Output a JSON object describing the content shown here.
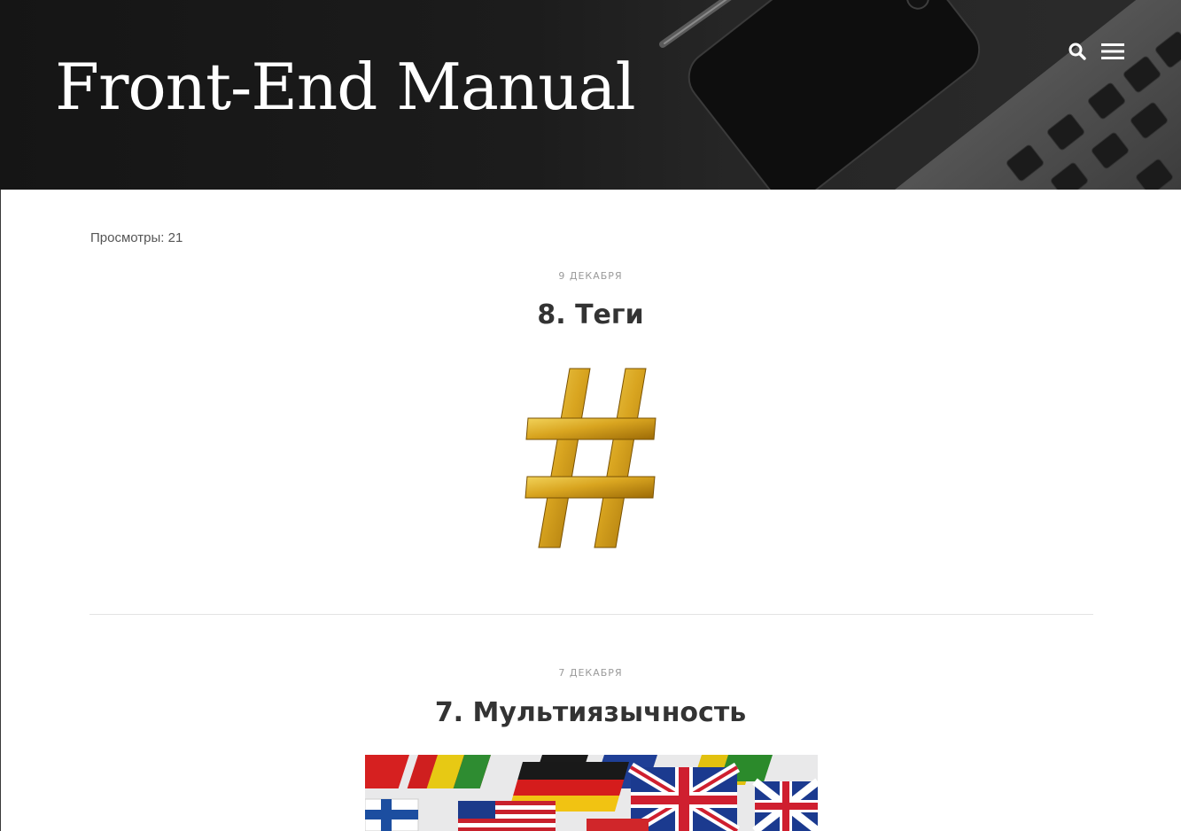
{
  "header": {
    "site_title": "Front-End Manual",
    "icons": [
      "search-icon",
      "menu-icon"
    ]
  },
  "views": {
    "text": "Просмотры: 21"
  },
  "posts": [
    {
      "date": "9 декабря",
      "title": "8. Теги",
      "image": "gold-hash-symbol"
    },
    {
      "date": "7 декабря",
      "title": "7. Мультиязычность",
      "image": "flag-keyboard-keys"
    }
  ],
  "colors": {
    "header_background": "#1a1a1a",
    "title_text": "#ffffff",
    "post_title": "#333333",
    "date_text": "#9a9a9a",
    "divider": "#e3e3e3",
    "gold": "#d9a520"
  }
}
